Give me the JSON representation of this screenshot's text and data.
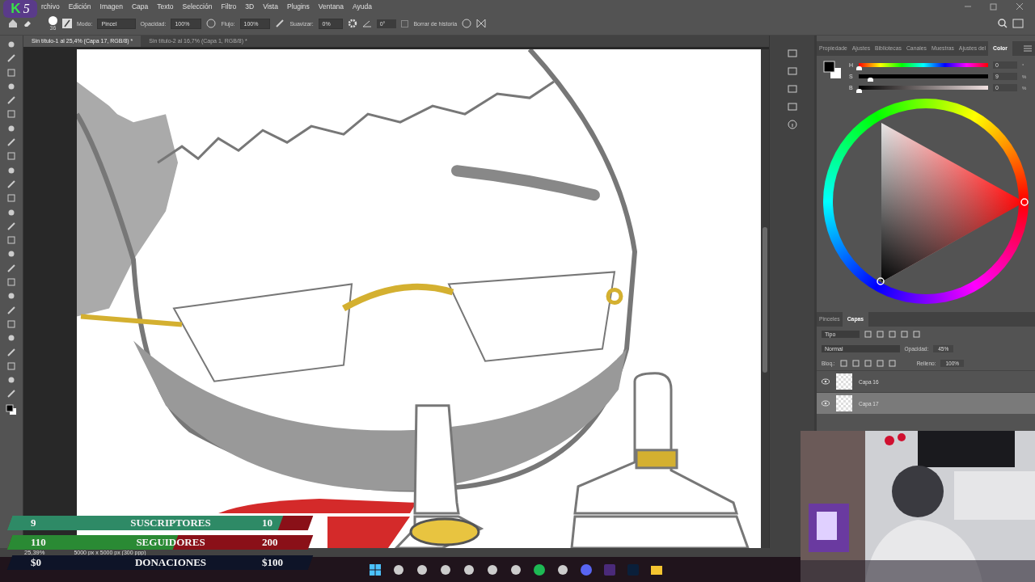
{
  "logo": {
    "letter": "K",
    "number": "5"
  },
  "menu_bar": {
    "items": [
      "rchivo",
      "Edición",
      "Imagen",
      "Capa",
      "Texto",
      "Selección",
      "Filtro",
      "3D",
      "Vista",
      "Plugins",
      "Ventana",
      "Ayuda"
    ]
  },
  "options_bar": {
    "brush_size": "36",
    "mode_label": "Modo:",
    "mode": "Pincel",
    "opacity_label": "Opacidad:",
    "opacity": "100%",
    "flow_label": "Flujo:",
    "flow": "100%",
    "smooth_label": "Suavizar:",
    "smooth": "0%",
    "angle": "0°",
    "erase_history": {
      "label": "Borrar de historia",
      "checked": false
    }
  },
  "doc_tabs": [
    {
      "label": "Sin título-1 al 25,4% (Capa 17, RGB/8) *",
      "selected": true
    },
    {
      "label": "Sin título-2 al 16,7% (Capa 1, RGB/8) *",
      "selected": false
    }
  ],
  "color_panel": {
    "tabs": [
      {
        "label": "Propiedade",
        "selected": false
      },
      {
        "label": "Ajustes",
        "selected": false
      },
      {
        "label": "Bibliotecas",
        "selected": false
      },
      {
        "label": "Canales",
        "selected": false
      },
      {
        "label": "Muestras",
        "selected": false
      },
      {
        "label": "Ajustes del",
        "selected": false
      },
      {
        "label": "Color",
        "selected": true
      }
    ],
    "sliders": [
      {
        "kind": "hue",
        "label": "H",
        "level": 0,
        "value": "0",
        "unit": "°"
      },
      {
        "kind": "saturation",
        "label": "S",
        "level": 0.09,
        "value": "9",
        "unit": "%"
      },
      {
        "kind": "brightness",
        "label": "B",
        "level": 0,
        "value": "0",
        "unit": "%"
      }
    ]
  },
  "layers_panel": {
    "tabs": [
      {
        "label": "Pinceles",
        "selected": false
      },
      {
        "label": "Capas",
        "selected": true
      }
    ],
    "filter": "Tipo",
    "blend_mode": "Normal",
    "opacity_label": "Opacidad:",
    "opacity": "45%",
    "lock_label": "Bloq.:",
    "fill_label": "Relleno:",
    "fill": "100%",
    "layers": [
      {
        "name": "Capa 16",
        "visible": true,
        "selected": false
      },
      {
        "name": "Capa 17",
        "visible": true,
        "selected": true
      }
    ]
  },
  "status_bar": {
    "zoom": "25,39%",
    "size": "5000 px x 5000 px (300 ppp)"
  },
  "stream_goals": [
    {
      "label": "SUSCRIPTORES",
      "current": "9",
      "goal": "10",
      "level": 0.9,
      "color": "#2e8a66"
    },
    {
      "label": "SEGUIDORES",
      "current": "110",
      "goal": "200",
      "level": 0.55,
      "color": "#2a8a34"
    },
    {
      "label": "DONACIONES",
      "current": "$0",
      "goal": "$100",
      "level": 0
    }
  ]
}
